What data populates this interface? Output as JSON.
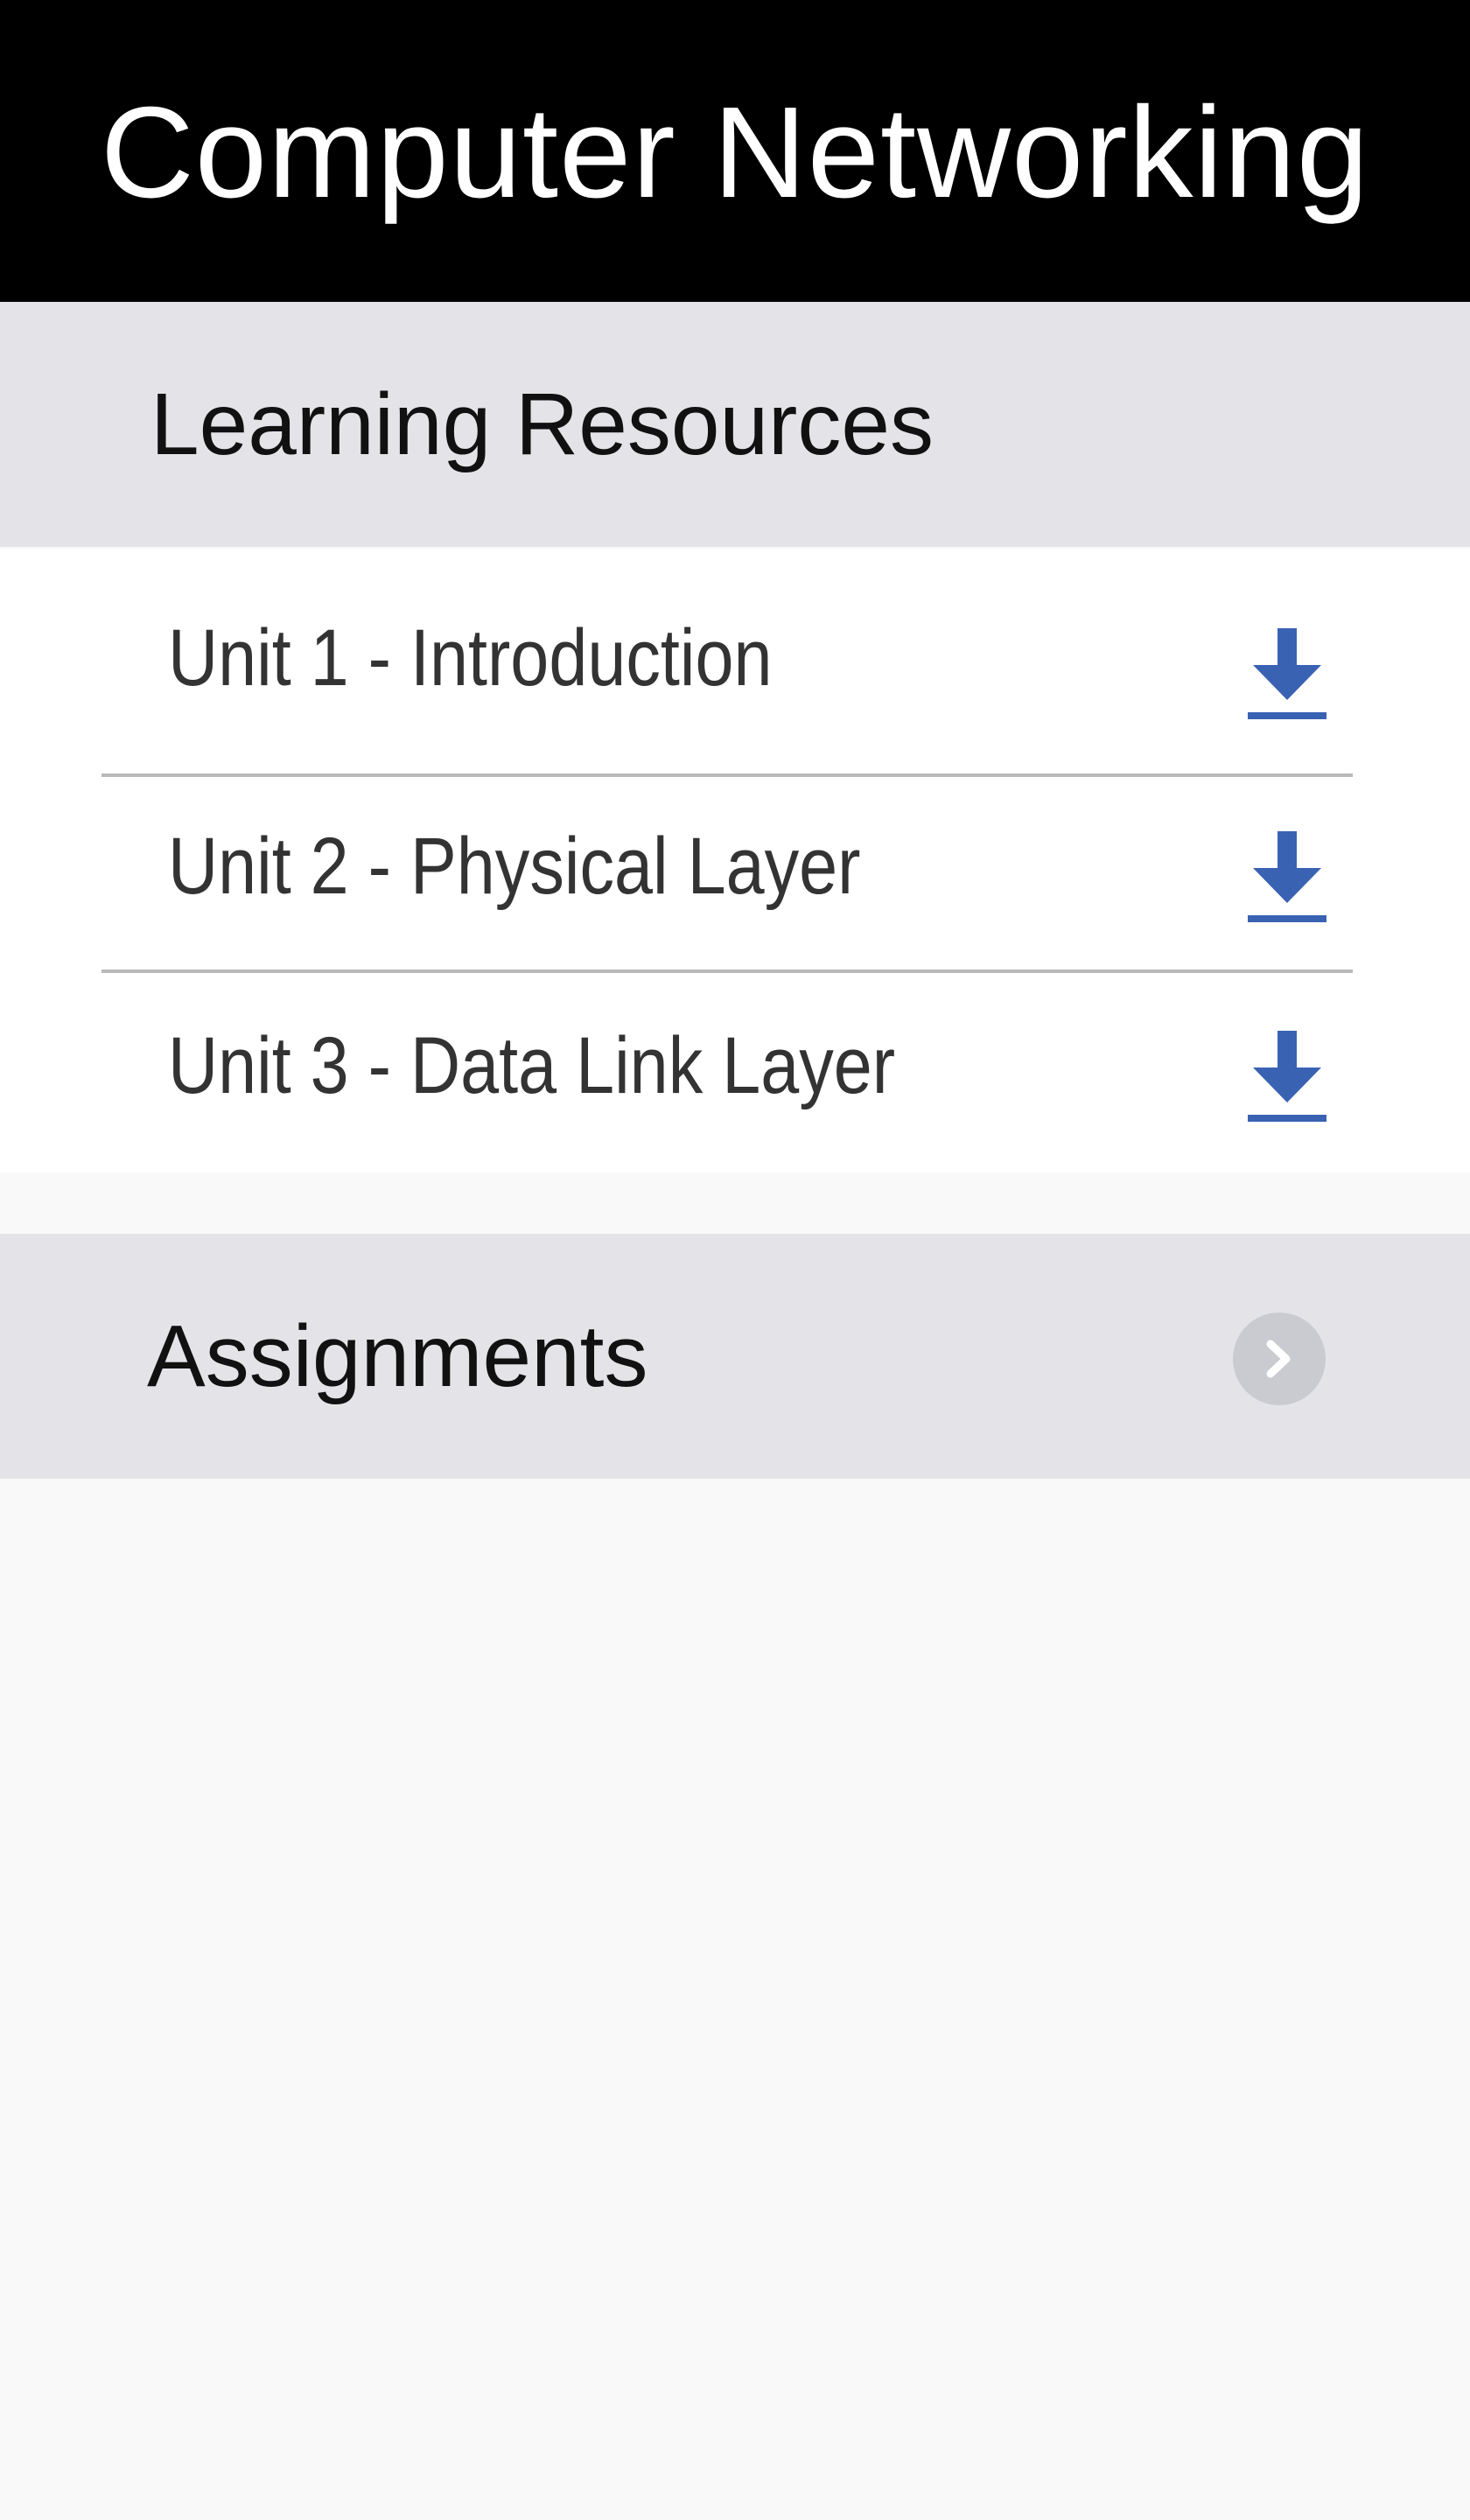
{
  "header": {
    "title": "Computer Networking"
  },
  "sections": {
    "resources": {
      "title": "Learning Resources",
      "items": [
        {
          "label": "Unit 1 - Introduction",
          "icon": "download-icon"
        },
        {
          "label": "Unit 2 - Physical Layer",
          "icon": "download-icon"
        },
        {
          "label": "Unit 3 - Data Link Layer",
          "icon": "download-icon"
        }
      ]
    },
    "assignments": {
      "title": "Assignments",
      "icon": "chevron-right-icon"
    }
  },
  "colors": {
    "header_bg": "#000000",
    "section_bg": "#e4e4e8",
    "accent": "#3a62b3",
    "divider": "#b9b9b9",
    "page_bg": "#f9f9f9"
  }
}
